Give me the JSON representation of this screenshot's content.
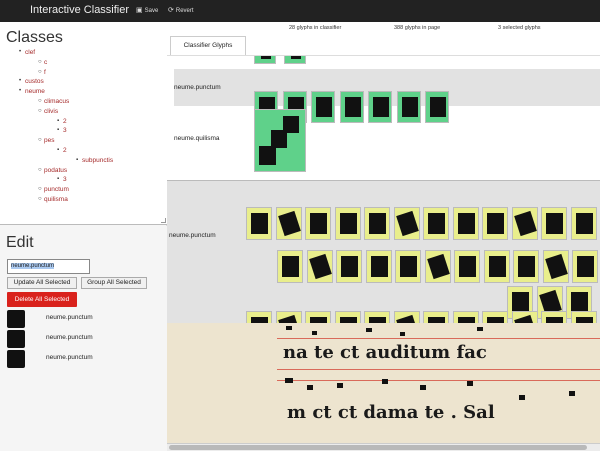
{
  "navbar": {
    "title": "Interactive Classifier",
    "save_label": "Save",
    "revert_label": "Revert"
  },
  "classes": {
    "heading": "Classes",
    "tree": [
      {
        "label": "clef",
        "children": [
          {
            "label": "c",
            "children": []
          },
          {
            "label": "f",
            "children": []
          }
        ]
      },
      {
        "label": "custos",
        "children": []
      },
      {
        "label": "neume",
        "children": [
          {
            "label": "climacus",
            "children": []
          },
          {
            "label": "clivis",
            "children": [
              {
                "label": "2",
                "children": []
              },
              {
                "label": "3",
                "children": []
              }
            ]
          },
          {
            "label": "pes",
            "children": [
              {
                "label": "2",
                "children": [
                  {
                    "label": "subpunctis",
                    "children": []
                  }
                ]
              }
            ]
          },
          {
            "label": "podatus",
            "children": [
              {
                "label": "3",
                "children": []
              }
            ]
          },
          {
            "label": "punctum",
            "children": []
          },
          {
            "label": "quilisma",
            "children": []
          }
        ]
      }
    ]
  },
  "edit": {
    "heading": "Edit",
    "name_value": "neume.punctum",
    "update_all_label": "Update All Selected",
    "group_all_label": "Group All Selected",
    "delete_all_label": "Delete All Selected",
    "selected": [
      {
        "label": "neume.punctum"
      },
      {
        "label": "neume.punctum"
      },
      {
        "label": "neume.punctum"
      }
    ]
  },
  "stats": {
    "classifier": "28 glyphs in classifier",
    "page": "388 glyphs in page",
    "selected": "3 selected glyphs"
  },
  "tab_label": "Classifier Glyphs",
  "classifier_rows": [
    {
      "label": "neume.punctum",
      "count": 7
    },
    {
      "label": "neume.quilisma",
      "count": 1
    }
  ],
  "page_rows": [
    {
      "label": "neume.punctum"
    }
  ],
  "manuscript": {
    "line1": "na  te   ct  auditum  fac",
    "line2": "m  ct  ct  dama   te  .  Sal"
  },
  "colors": {
    "navbar": "#222222",
    "class_link": "#a52a2a",
    "classifier_glyph_bg": "#5fd18a",
    "page_glyph_bg": "#e9ee8c",
    "delete_button": "#d9221c"
  }
}
